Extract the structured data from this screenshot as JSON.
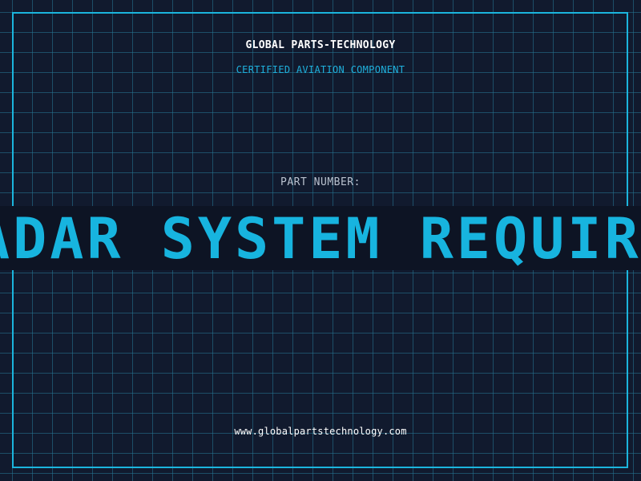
{
  "header": {
    "brand": "GLOBAL PARTS-TECHNOLOGY",
    "tagline": "CERTIFIED AVIATION COMPONENT"
  },
  "part": {
    "label": "PART NUMBER:",
    "value": "ADAR SYSTEM REQUIR"
  },
  "footer": {
    "url": "www.globalpartstechnology.com"
  },
  "colors": {
    "background": "#111a2e",
    "grid": "#267896",
    "accent": "#1bb5dd",
    "banner": "#0d1424"
  }
}
